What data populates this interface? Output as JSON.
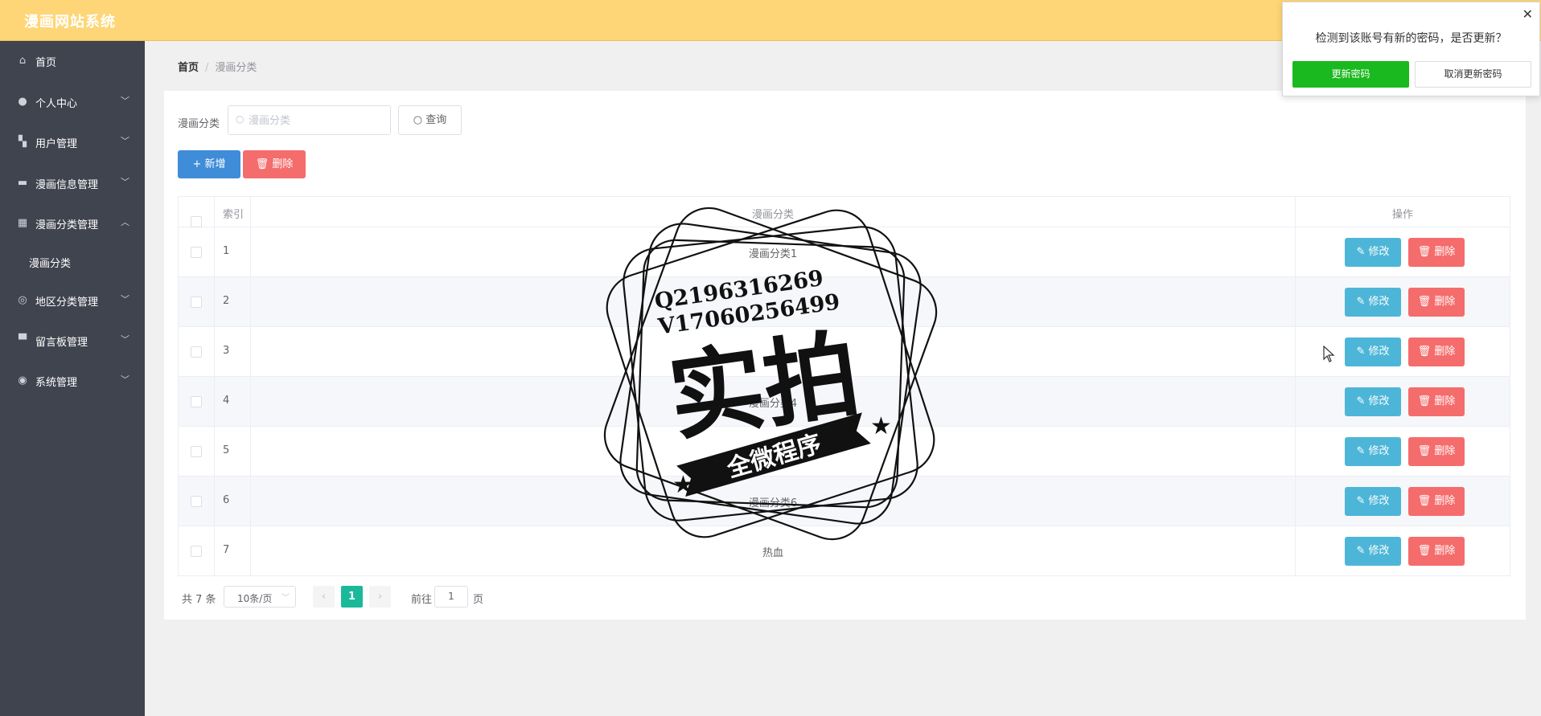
{
  "app": {
    "title": "漫画网站系统"
  },
  "sidebar": {
    "items": [
      {
        "label": "首页",
        "icon": "home-icon",
        "has_arrow": false
      },
      {
        "label": "个人中心",
        "icon": "user-icon",
        "has_arrow": true
      },
      {
        "label": "用户管理",
        "icon": "users-icon",
        "has_arrow": true
      },
      {
        "label": "漫画信息管理",
        "icon": "briefcase-icon",
        "has_arrow": true
      },
      {
        "label": "漫画分类管理",
        "icon": "grid-icon",
        "has_arrow": true,
        "expanded": true
      },
      {
        "label": "地区分类管理",
        "icon": "compass-icon",
        "has_arrow": true
      },
      {
        "label": "留言板管理",
        "icon": "monitor-icon",
        "has_arrow": true
      },
      {
        "label": "系统管理",
        "icon": "location-pin-icon",
        "has_arrow": true
      }
    ],
    "submenu": {
      "label": "漫画分类"
    }
  },
  "breadcrumb": {
    "home": "首页",
    "separator": "/",
    "current": "漫画分类"
  },
  "search": {
    "label": "漫画分类",
    "placeholder": "漫画分类",
    "value": "",
    "button": "查询"
  },
  "actions": {
    "add": "新增",
    "delete": "删除"
  },
  "table": {
    "headers": {
      "index": "索引",
      "name": "漫画分类",
      "ops": "操作"
    },
    "rows": [
      {
        "index": "1",
        "name": "漫画分类1"
      },
      {
        "index": "2",
        "name": ""
      },
      {
        "index": "3",
        "name": ""
      },
      {
        "index": "4",
        "name": "漫画分类4"
      },
      {
        "index": "5",
        "name": ""
      },
      {
        "index": "6",
        "name": "漫画分类6"
      },
      {
        "index": "7",
        "name": "热血"
      }
    ],
    "row_edit": "修改",
    "row_delete": "删除"
  },
  "pagination": {
    "total": "共 7 条",
    "page_size": "10条/页",
    "current_page": "1",
    "goto_label": "前往",
    "goto_value": "1",
    "page_suffix": "页"
  },
  "popup": {
    "message": "检测到该账号有新的密码，是否更新？",
    "confirm": "更新密码",
    "cancel": "取消更新密码"
  },
  "watermark": {
    "line1": "Q2196316269",
    "line2": "V17060256499",
    "main": "实拍",
    "ribbon": "全微程序"
  },
  "colors": {
    "topbar": "#fed677",
    "sidebar": "#40444f",
    "primary": "#3f8cd8",
    "danger": "#f56c6c",
    "info": "#4db6d8",
    "success_popup": "#1ab91f",
    "pager_active": "#1bb99a"
  }
}
